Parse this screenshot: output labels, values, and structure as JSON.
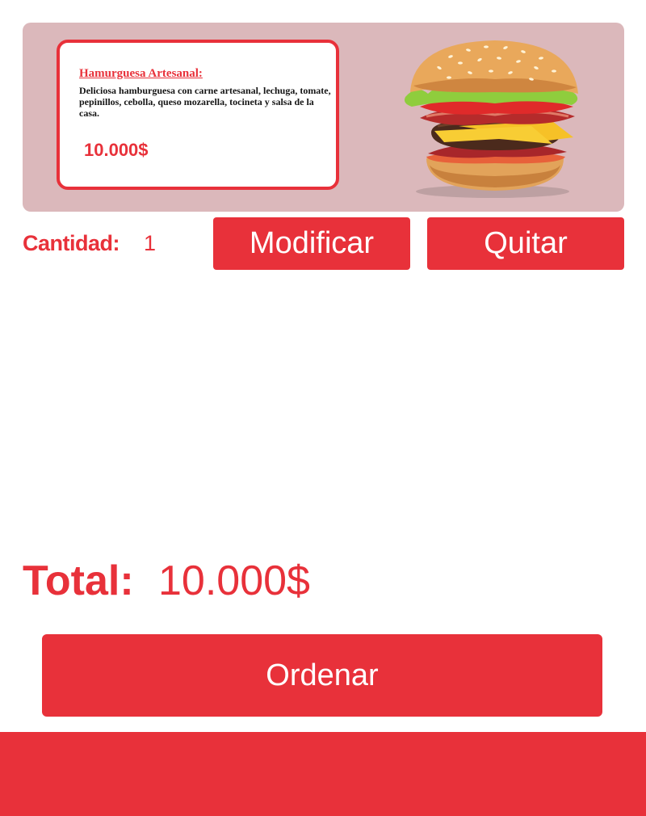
{
  "product": {
    "name": "Hamurguesa Artesanal:",
    "description": "Deliciosa hamburguesa con carne artesanal, lechuga, tomate, pepinillos, cebolla, queso mozarella, tocineta y salsa de la casa.",
    "price": "10.000$",
    "image_icon": "burger-image"
  },
  "quantity": {
    "label": "Cantidad:",
    "value": "1"
  },
  "actions": {
    "modify_label": "Modificar",
    "remove_label": "Quitar"
  },
  "total": {
    "label": "Total:",
    "value": "10.000$"
  },
  "order": {
    "label": "Ordenar"
  },
  "colors": {
    "accent": "#e8313a",
    "card_background": "#dbb8bb",
    "background": "#ffffff"
  }
}
